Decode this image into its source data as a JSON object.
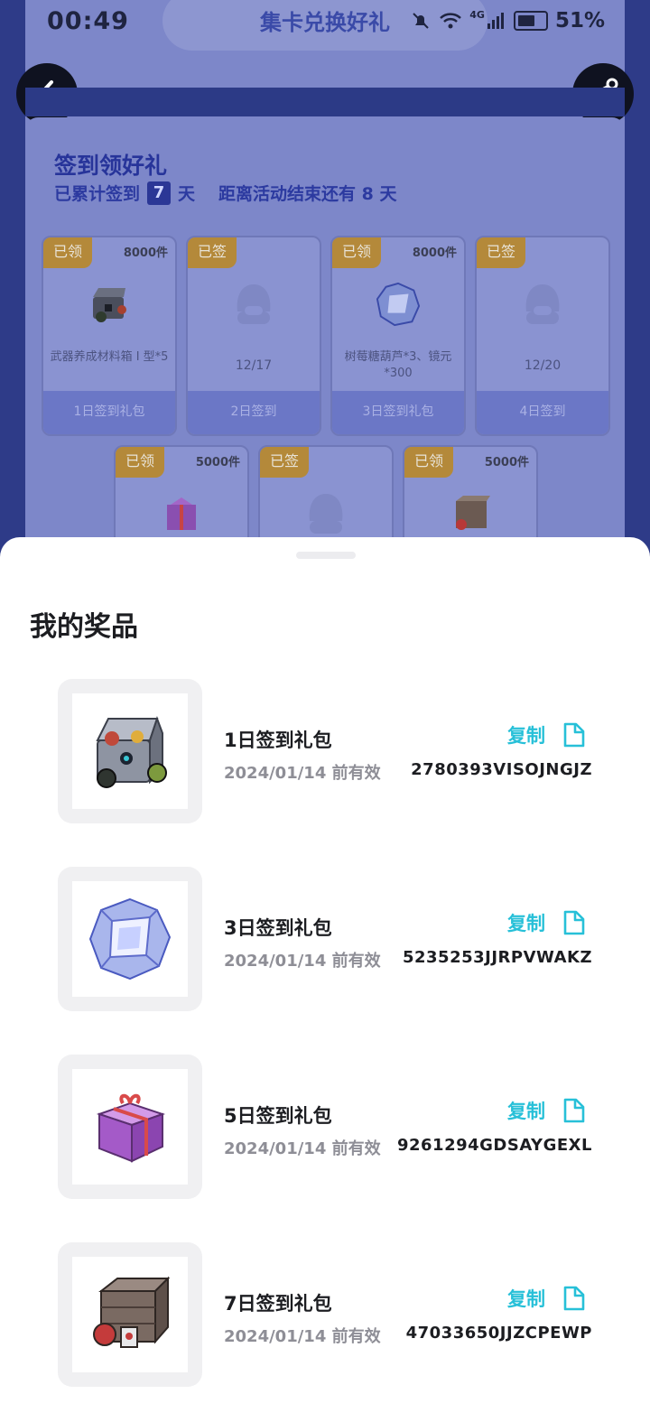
{
  "status_bar": {
    "time": "00:49",
    "signal": "4G",
    "battery": "51%"
  },
  "header": {
    "title": "集卡兑换好礼"
  },
  "signin": {
    "title": "签到领好礼",
    "days_prefix": "已累计签到",
    "days_count": "7",
    "days_suffix": "天",
    "remaining": "距离活动结束还有 8 天",
    "tiles": [
      {
        "tag": "已领",
        "count": "8000件",
        "desc": "武器养成材料箱 I 型*5",
        "footer": "1日签到礼包"
      },
      {
        "tag": "已签",
        "count": "",
        "desc": "12/17",
        "footer": "2日签到"
      },
      {
        "tag": "已领",
        "count": "8000件",
        "desc": "树莓糖葫芦*3、镜元*300",
        "footer": "3日签到礼包"
      },
      {
        "tag": "已签",
        "count": "",
        "desc": "12/20",
        "footer": "4日签到"
      },
      {
        "tag": "已领",
        "count": "5000件"
      },
      {
        "tag": "已签",
        "count": ""
      },
      {
        "tag": "已领",
        "count": "5000件"
      }
    ]
  },
  "sheet": {
    "title": "我的奖品",
    "copy_label": "复制",
    "prizes": [
      {
        "name": "1日签到礼包",
        "date": "2024/01/14 前有效",
        "code": "2780393VISOJNGJZ"
      },
      {
        "name": "3日签到礼包",
        "date": "2024/01/14 前有效",
        "code": "5235253JJRPVWAKZ"
      },
      {
        "name": "5日签到礼包",
        "date": "2024/01/14 前有效",
        "code": "9261294GDSAYGEXL"
      },
      {
        "name": "7日签到礼包",
        "date": "2024/01/14 前有效",
        "code": "47033650JJZCPEWP"
      }
    ]
  }
}
